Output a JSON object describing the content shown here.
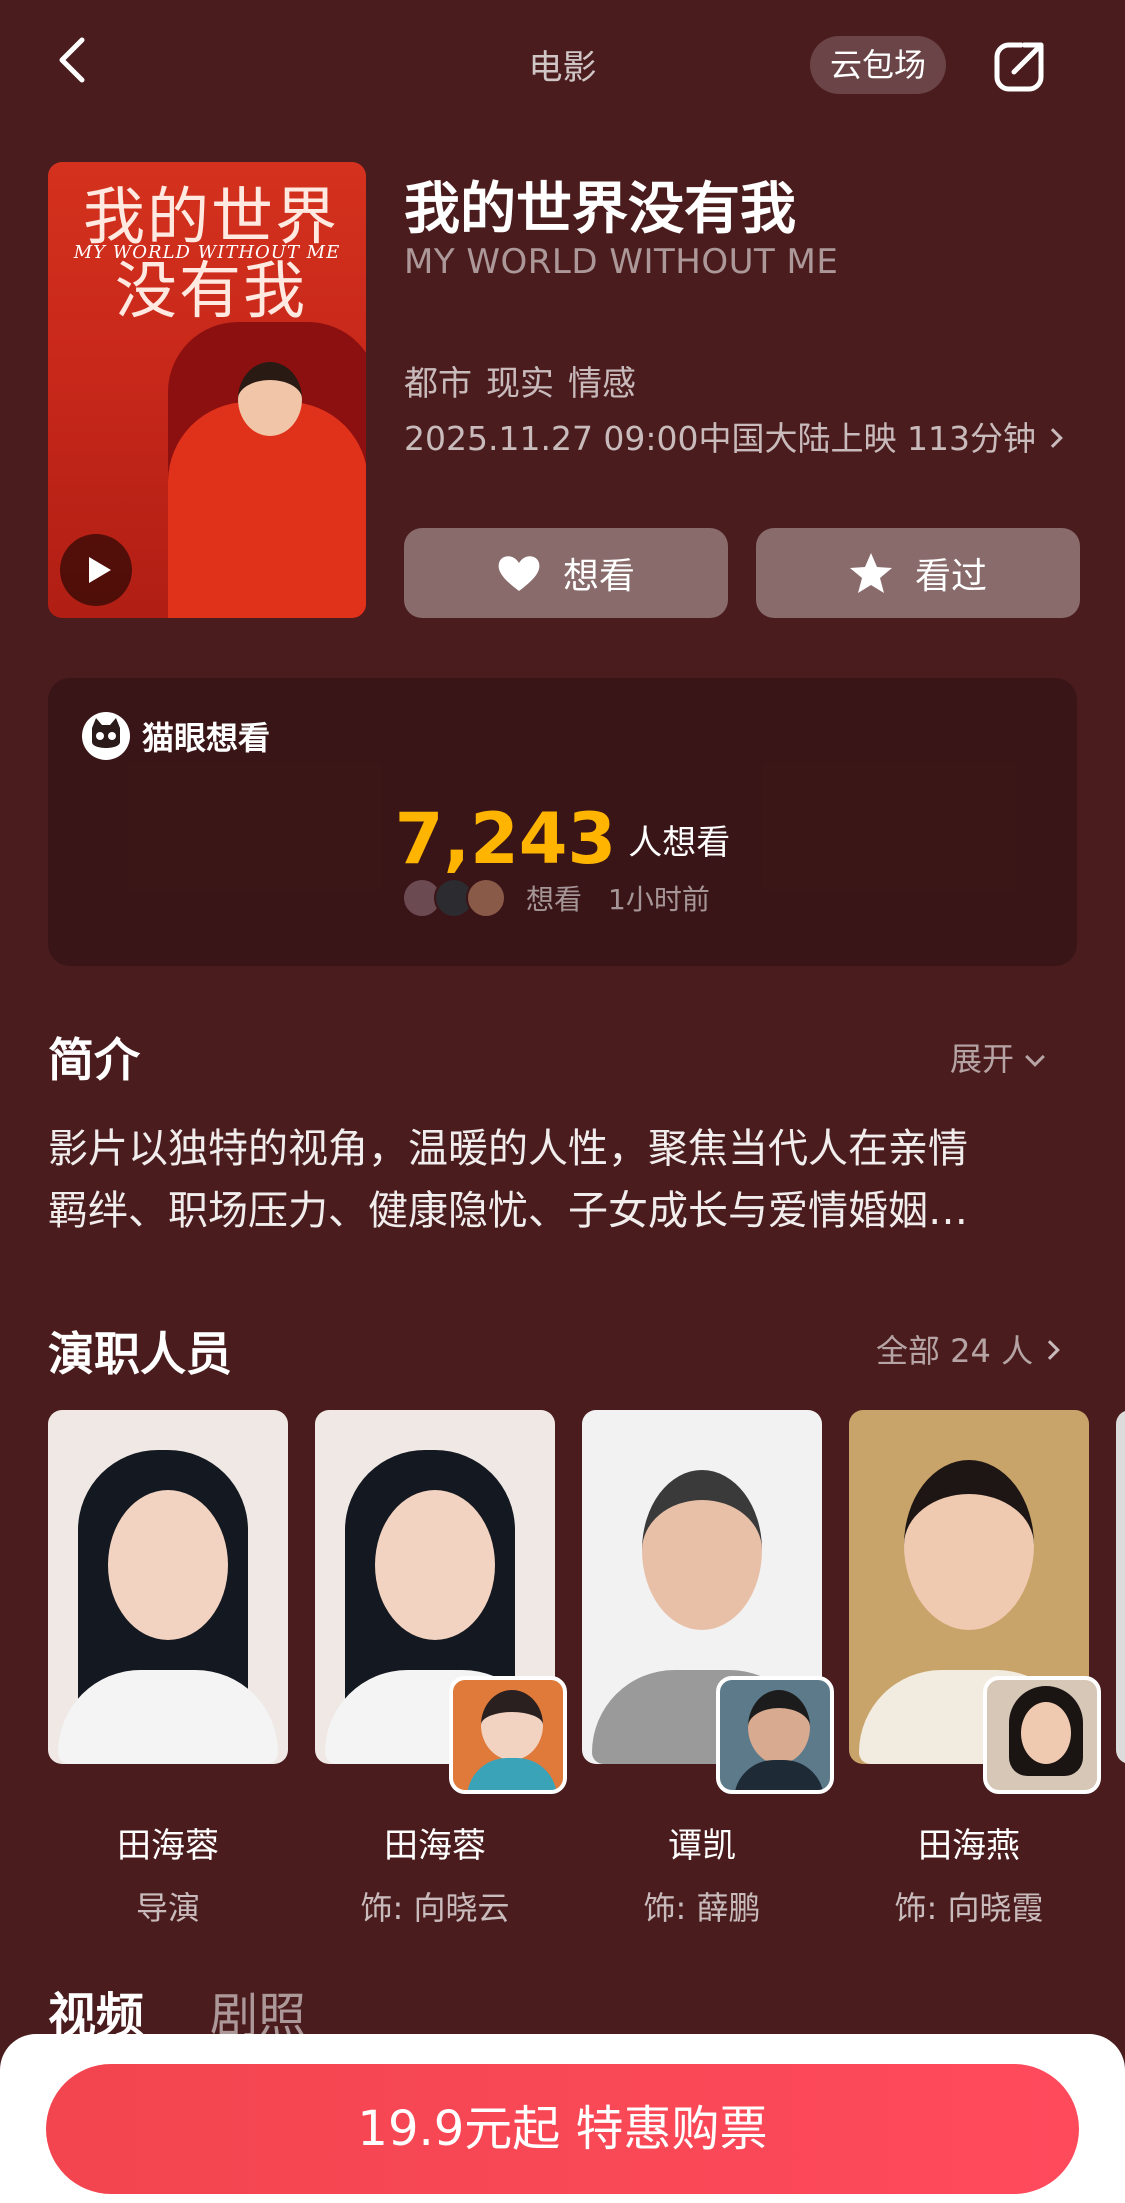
{
  "nav": {
    "title": "电影",
    "pill_label": "云包场"
  },
  "movie": {
    "title": "我的世界没有我",
    "title_en": "MY WORLD WITHOUT ME",
    "tags": [
      "都市",
      "现实",
      "情感"
    ],
    "release": "2025.11.27 09:00中国大陆上映 113分钟",
    "poster_title_line1": "我的世界",
    "poster_title_line2": "没有我",
    "poster_en": "MY WORLD WITHOUT ME",
    "want_label": "想看",
    "seen_label": "看过"
  },
  "maoyan": {
    "brand": "猫眼想看",
    "count": "7,243",
    "count_label": "人想看",
    "recent_action": "想看",
    "recent_time": "1小时前"
  },
  "intro": {
    "title": "简介",
    "expand_label": "展开",
    "line1": "影片以独特的视角，温暖的人性，聚焦当代人在亲情",
    "line2": "羁绊、职场压力、健康隐忧、子女成长与爱情婚姻…"
  },
  "cast": {
    "title": "演职人员",
    "all_label": "全部 24 人",
    "members": [
      {
        "name": "田海蓉",
        "role": "导演"
      },
      {
        "name": "田海蓉",
        "role": "饰: 向晓云"
      },
      {
        "name": "谭凯",
        "role": "饰: 薛鹏"
      },
      {
        "name": "田海燕",
        "role": "饰: 向晓霞"
      }
    ]
  },
  "tabs": {
    "video": "视频",
    "stills": "剧照"
  },
  "purchase": {
    "label": "19.9元起 特惠购票"
  },
  "colors": {
    "background": "#4a1c1e",
    "accent_count": "#ffb400",
    "buy_button": "#f2454f"
  }
}
